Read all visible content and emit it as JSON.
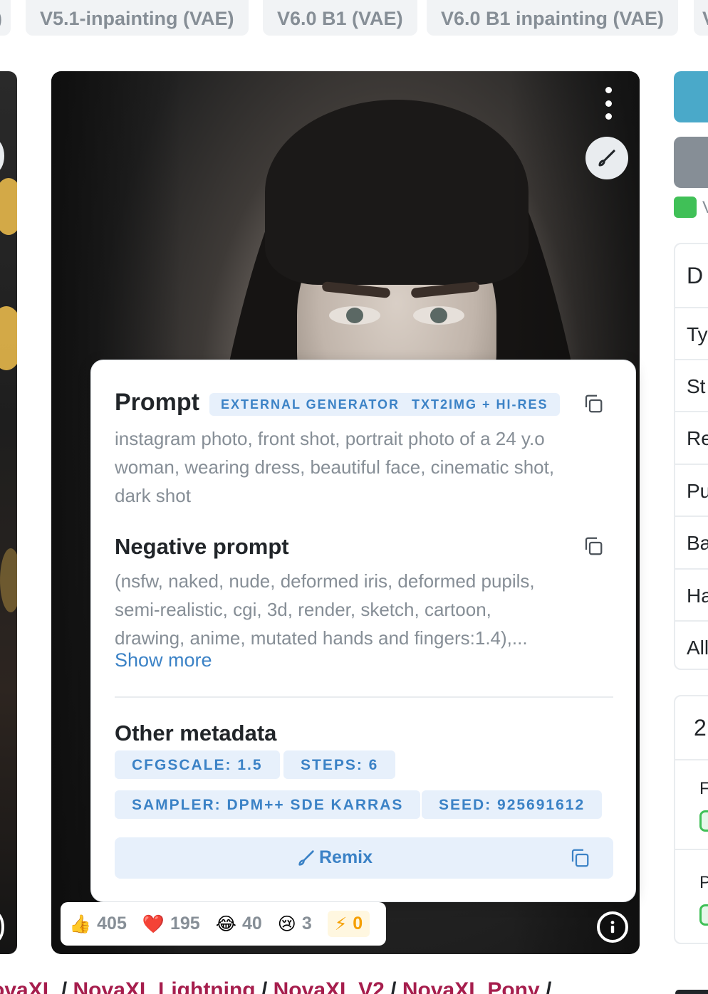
{
  "tabs": [
    ")",
    "V5.1-inpainting (VAE)",
    "V6.0 B1 (VAE)",
    "V6.0 B1 inpainting (VAE)",
    "V"
  ],
  "popup": {
    "prompt_title": "Prompt",
    "badges": [
      "EXTERNAL GENERATOR",
      "TXT2IMG + HI-RES"
    ],
    "prompt_lines": [
      "instagram photo, front shot, portrait photo of a 24 y.o",
      "woman, wearing dress, beautiful face, cinematic shot,",
      "dark shot"
    ],
    "negative_title": "Negative prompt",
    "negative_lines": [
      "(nsfw, naked, nude, deformed iris, deformed pupils,",
      "semi-realistic, cgi, 3d, render, sketch, cartoon,",
      "drawing, anime, mutated hands and fingers:1.4),..."
    ],
    "show_more": "Show more",
    "other_title": "Other metadata",
    "meta": [
      "CFGSCALE: 1.5",
      "STEPS: 6",
      "SAMPLER: DPM++ SDE KARRAS",
      "SEED: 925691612"
    ],
    "remix_label": "Remix"
  },
  "reactions": [
    {
      "emoji": "👍",
      "count": "405"
    },
    {
      "emoji": "❤️",
      "count": "195"
    },
    {
      "emoji": "😂",
      "count": "40"
    },
    {
      "emoji": "😢",
      "count": "3"
    },
    {
      "emoji": "⚡",
      "count": "0"
    }
  ],
  "sidebar": {
    "shield_text": "V",
    "rows": [
      "D",
      "Ty",
      "St",
      "Re",
      "Pu",
      "Ba",
      "Ha",
      "All"
    ],
    "panel2_num": "2",
    "panel2_rows": [
      "F",
      "P"
    ]
  },
  "bottom_links": [
    "ovaXL",
    "NovaXL Lightning",
    "NovaXL V2",
    "NovaXL Pony"
  ],
  "colors": {
    "accent": "#3b82c6",
    "badge_bg": "#e7f0fb",
    "link": "#a61e4d",
    "shield": "#40c057"
  }
}
